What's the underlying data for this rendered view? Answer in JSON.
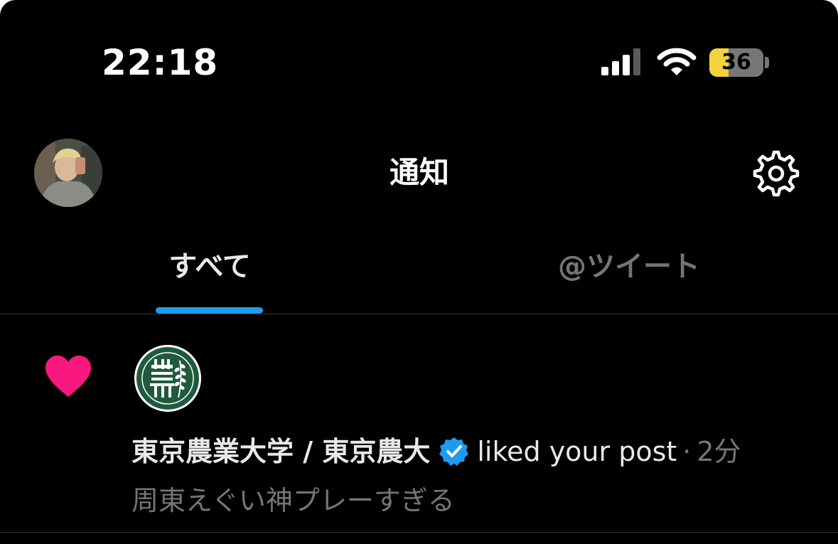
{
  "status_bar": {
    "time": "22:18",
    "battery_percent": "36",
    "battery_level": 0.36,
    "signal_icon": "signal-bars-icon",
    "wifi_icon": "wifi-icon"
  },
  "header": {
    "title": "通知",
    "avatar": "profile-avatar",
    "settings_icon": "gear-icon"
  },
  "tabs": [
    {
      "label": "すべて",
      "active": true
    },
    {
      "label": "@ツイート",
      "active": false
    }
  ],
  "notifications": [
    {
      "type_icon": "heart-icon",
      "actor_name": "東京農業大学 / 東京農大",
      "verified": true,
      "action": "liked your post",
      "separator": "·",
      "time": "2分",
      "post_preview": "周東えぐい神プレーすぎる"
    }
  ],
  "colors": {
    "background": "#000000",
    "accent": "#1d9bf0",
    "heart": "#f91880",
    "secondary_text": "#71767b",
    "battery_low_power": "#f2d33c"
  }
}
